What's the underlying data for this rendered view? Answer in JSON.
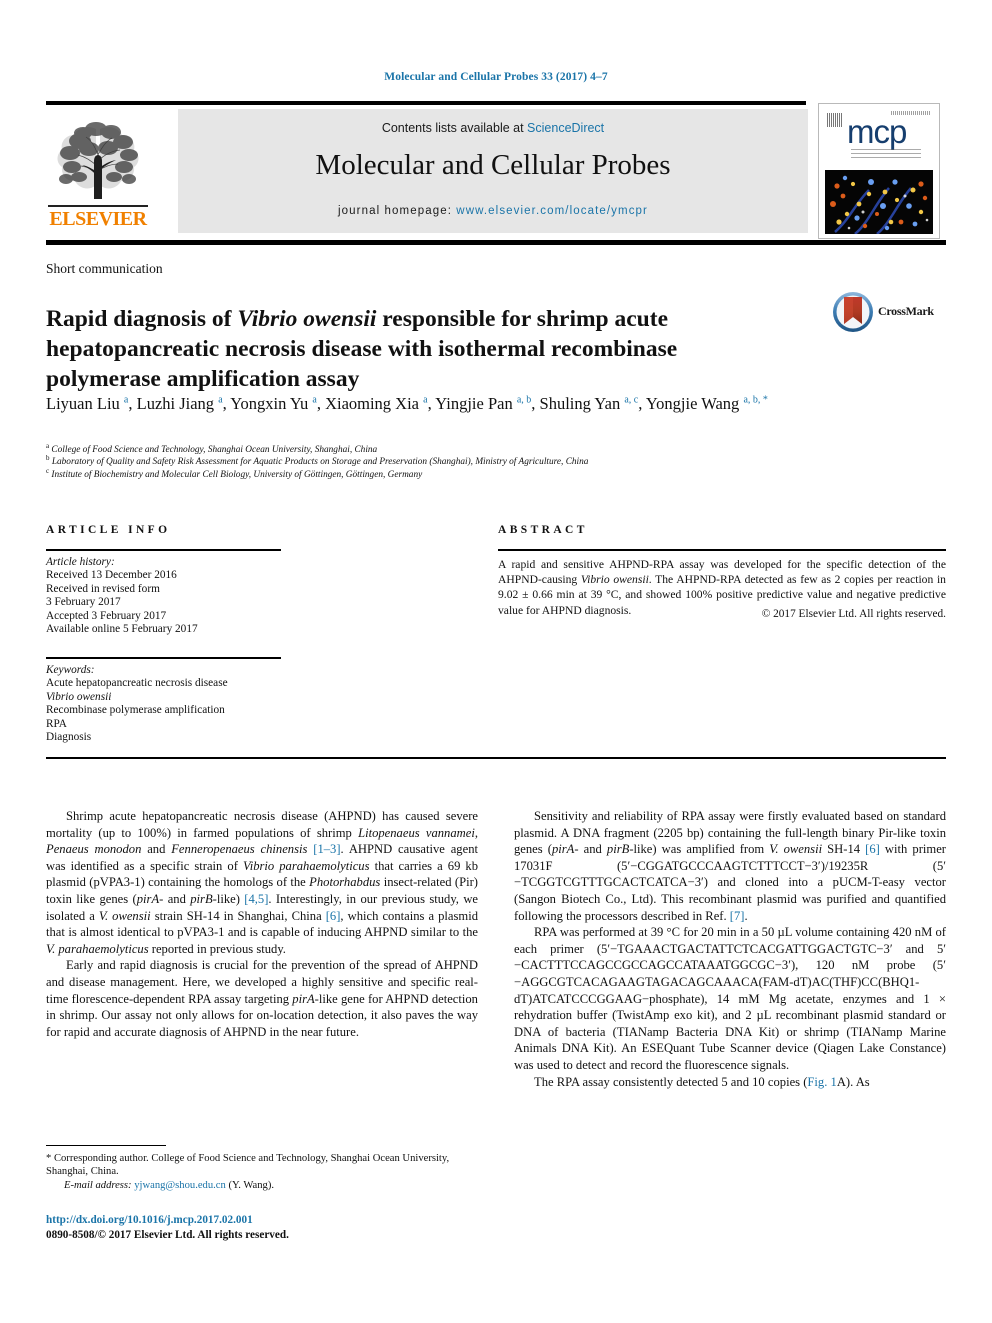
{
  "running_head": "Molecular and Cellular Probes 33 (2017) 4–7",
  "masthead": {
    "contents_prefix": "Contents lists available at ",
    "sciencedirect": "ScienceDirect",
    "journal_title": "Molecular and Cellular Probes",
    "homepage_prefix": "journal homepage: ",
    "homepage_url": "www.elsevier.com/locate/ymcpr",
    "publisher": "ELSEVIER",
    "cover_logo_text": "mcp",
    "accent_link": "#1a74a8",
    "banner_bg": "#e6e6e6",
    "elsevier_orange": "#f08000"
  },
  "article": {
    "type": "Short communication",
    "title_parts": [
      {
        "text": "Rapid diagnosis of ",
        "italic": false
      },
      {
        "text": "Vibrio owensii",
        "italic": true
      },
      {
        "text": " responsible for shrimp acute hepatopancreatic necrosis disease with isothermal recombinase polymerase amplification assay",
        "italic": false
      }
    ],
    "crossmark_label": "CrossMark",
    "authors": [
      {
        "name": "Liyuan Liu",
        "marks": "a",
        "sep": ", "
      },
      {
        "name": "Luzhi Jiang",
        "marks": "a",
        "sep": ", "
      },
      {
        "name": "Yongxin Yu",
        "marks": "a",
        "sep": ", "
      },
      {
        "name": "Xiaoming Xia",
        "marks": "a",
        "sep": ", "
      },
      {
        "name": "Yingjie Pan",
        "marks": "a, b",
        "sep": ", "
      },
      {
        "name": "Shuling Yan",
        "marks": "a, c",
        "sep": ", "
      },
      {
        "name": "Yongjie Wang",
        "marks": "a, b, *",
        "sep": ""
      }
    ],
    "affiliations": [
      {
        "mark": "a",
        "text": "College of Food Science and Technology, Shanghai Ocean University, Shanghai, China"
      },
      {
        "mark": "b",
        "text": "Laboratory of Quality and Safety Risk Assessment for Aquatic Products on Storage and Preservation (Shanghai), Ministry of Agriculture, China"
      },
      {
        "mark": "c",
        "text": "Institute of Biochemistry and Molecular Cell Biology, University of Göttingen, Göttingen, Germany"
      }
    ]
  },
  "info": {
    "heading": "ARTICLE INFO",
    "history_label": "Article history:",
    "history_lines": [
      "Received 13 December 2016",
      "Received in revised form",
      "3 February 2017",
      "Accepted 3 February 2017",
      "Available online 5 February 2017"
    ],
    "keywords_label": "Keywords:",
    "keywords": [
      {
        "text": "Acute hepatopancreatic necrosis disease",
        "italic": false
      },
      {
        "text": "Vibrio owensii",
        "italic": true
      },
      {
        "text": "Recombinase polymerase amplification",
        "italic": false
      },
      {
        "text": "RPA",
        "italic": false
      },
      {
        "text": "Diagnosis",
        "italic": false
      }
    ]
  },
  "abstract": {
    "heading": "ABSTRACT",
    "parts": [
      {
        "text": "A rapid and sensitive AHPND-RPA assay was developed for the specific detection of the AHPND-causing ",
        "italic": false
      },
      {
        "text": "Vibrio owensii",
        "italic": true
      },
      {
        "text": ". The AHPND-RPA detected as few as 2 copies per reaction in 9.02 ± 0.66 min at 39 °C, and showed 100% positive predictive value and negative predictive value for AHPND diagnosis.",
        "italic": false
      }
    ],
    "copyright": "© 2017 Elsevier Ltd. All rights reserved."
  },
  "body": {
    "left_column": [
      {
        "indent": true,
        "parts": [
          {
            "text": "Shrimp acute hepatopancreatic necrosis disease (AHPND) has caused severe mortality (up to 100%) in farmed populations of shrimp ",
            "style": "normal"
          },
          {
            "text": "Litopenaeus vannamei",
            "style": "italic"
          },
          {
            "text": ", ",
            "style": "normal"
          },
          {
            "text": "Penaeus monodon",
            "style": "italic"
          },
          {
            "text": " and ",
            "style": "normal"
          },
          {
            "text": "Fenneropenaeus chinensis",
            "style": "italic"
          },
          {
            "text": " ",
            "style": "normal"
          },
          {
            "text": "[1–3]",
            "style": "ref"
          },
          {
            "text": ". AHPND causative agent was identified as a specific strain of ",
            "style": "normal"
          },
          {
            "text": "Vibrio parahaemolyticus",
            "style": "italic"
          },
          {
            "text": " that carries a 69 kb plasmid (pVPA3-1) containing the homologs of the ",
            "style": "normal"
          },
          {
            "text": "Photorhabdus",
            "style": "italic"
          },
          {
            "text": " insect-related (Pir) toxin like genes (",
            "style": "normal"
          },
          {
            "text": "pirA",
            "style": "italic"
          },
          {
            "text": "- and ",
            "style": "normal"
          },
          {
            "text": "pirB",
            "style": "italic"
          },
          {
            "text": "-like) ",
            "style": "normal"
          },
          {
            "text": "[4,5]",
            "style": "ref"
          },
          {
            "text": ". Interestingly, in our previous study, we isolated a ",
            "style": "normal"
          },
          {
            "text": "V. owensii",
            "style": "italic"
          },
          {
            "text": " strain SH-14 in Shanghai, China ",
            "style": "normal"
          },
          {
            "text": "[6]",
            "style": "ref"
          },
          {
            "text": ", which contains a plasmid that is almost identical to pVPA3-1 and is capable of inducing AHPND similar to the ",
            "style": "normal"
          },
          {
            "text": "V. parahaemolyticus",
            "style": "italic"
          },
          {
            "text": " reported in previous study.",
            "style": "normal"
          }
        ]
      },
      {
        "indent": true,
        "parts": [
          {
            "text": "Early and rapid diagnosis is crucial for the prevention of the spread of AHPND and disease management. Here, we developed a highly sensitive and specific real-time florescence-dependent RPA assay targeting ",
            "style": "normal"
          },
          {
            "text": "pirA",
            "style": "italic"
          },
          {
            "text": "-like gene for AHPND detection in shrimp. Our assay not only allows for on-location detection, it also paves the way for rapid and accurate diagnosis of AHPND in the near future.",
            "style": "normal"
          }
        ]
      }
    ],
    "right_column": [
      {
        "indent": true,
        "parts": [
          {
            "text": "Sensitivity and reliability of RPA assay were firstly evaluated based on standard plasmid. A DNA fragment (2205 bp) containing the full-length binary Pir-like toxin genes (",
            "style": "normal"
          },
          {
            "text": "pirA",
            "style": "italic"
          },
          {
            "text": "- and ",
            "style": "normal"
          },
          {
            "text": "pirB",
            "style": "italic"
          },
          {
            "text": "-like) was amplified from ",
            "style": "normal"
          },
          {
            "text": "V. owensii",
            "style": "italic"
          },
          {
            "text": " SH-14 ",
            "style": "normal"
          },
          {
            "text": "[6]",
            "style": "ref"
          },
          {
            "text": " with primer 17031F (5′−CGGATGCCCAAGTCTTTCCT−3′)/19235R (5′−TCGGTCGTTTGCACTCATCA−3′) and cloned into a pUCM-T-easy vector (Sangon Biotech Co., Ltd). This recombinant plasmid was purified and quantified following the processors described in Ref. ",
            "style": "normal"
          },
          {
            "text": "[7]",
            "style": "ref"
          },
          {
            "text": ".",
            "style": "normal"
          }
        ]
      },
      {
        "indent": true,
        "parts": [
          {
            "text": "RPA was performed at 39 °C for 20 min in a 50 µL volume containing 420 nM of each primer (5′−TGAAACTGACTATTCTCACGATTGGACTGTC−3′ and 5′−CACTTTCCAGCCGCCAGCCATAAATGGCGC−3′), 120 nM probe (5′−AGGCGTCACAGAAGTAGACAGCAAACA(FAM-dT)AC(THF)CC(BHQ1-dT)ATCATCCCGGAAG−phosphate), 14 mM Mg acetate, enzymes and 1 × rehydration buffer (TwistAmp exo kit), and 2 µL recombinant plasmid standard or DNA of bacteria (TIANamp Bacteria DNA Kit) or shrimp (TIANamp Marine Animals DNA Kit). An ESEQuant Tube Scanner device (Qiagen Lake Constance) was used to detect and record the fluorescence signals.",
            "style": "normal"
          }
        ]
      },
      {
        "indent": true,
        "parts": [
          {
            "text": "The RPA assay consistently detected 5 and 10 copies (",
            "style": "normal"
          },
          {
            "text": "Fig. 1",
            "style": "ref"
          },
          {
            "text": "A). As",
            "style": "normal"
          }
        ]
      }
    ]
  },
  "footer": {
    "corresponding": "* Corresponding author. College of Food Science and Technology, Shanghai Ocean University, Shanghai, China.",
    "email_label": "E-mail address:",
    "email": "yjwang@shou.edu.cn",
    "email_suffix": "(Y. Wang).",
    "doi": "http://dx.doi.org/10.1016/j.mcp.2017.02.001",
    "issn": "0890-8508/© 2017 Elsevier Ltd. All rights reserved."
  }
}
